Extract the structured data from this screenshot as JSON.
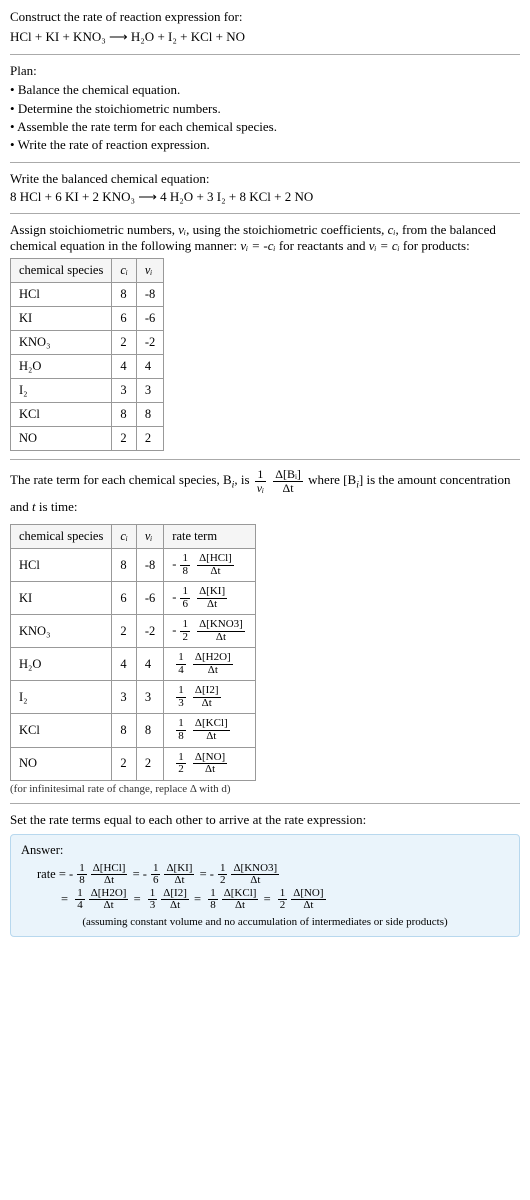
{
  "prompt": {
    "title": "Construct the rate of reaction expression for:",
    "equation_unbalanced": "HCl + KI + KNO₃  ⟶  H₂O + I₂ + KCl + NO"
  },
  "plan": {
    "title": "Plan:",
    "items": [
      "Balance the chemical equation.",
      "Determine the stoichiometric numbers.",
      "Assemble the rate term for each chemical species.",
      "Write the rate of reaction expression."
    ]
  },
  "balanced": {
    "title": "Write the balanced chemical equation:",
    "equation": "8 HCl + 6 KI + 2 KNO₃  ⟶  4 H₂O + 3 I₂ + 8 KCl + 2 NO"
  },
  "stoich": {
    "intro_a": "Assign stoichiometric numbers, ",
    "intro_b": ", using the stoichiometric coefficients, ",
    "intro_c": ", from the balanced chemical equation in the following manner: ",
    "intro_d": " for reactants and ",
    "intro_e": " for products:",
    "headers": {
      "species": "chemical species",
      "c": "cᵢ",
      "v": "νᵢ"
    },
    "rows": [
      {
        "sp": "HCl",
        "c": "8",
        "v": "-8"
      },
      {
        "sp": "KI",
        "c": "6",
        "v": "-6"
      },
      {
        "sp": "KNO₃",
        "c": "2",
        "v": "-2"
      },
      {
        "sp": "H₂O",
        "c": "4",
        "v": "4"
      },
      {
        "sp": "I₂",
        "c": "3",
        "v": "3"
      },
      {
        "sp": "KCl",
        "c": "8",
        "v": "8"
      },
      {
        "sp": "NO",
        "c": "2",
        "v": "2"
      }
    ]
  },
  "rateterm": {
    "intro_a": "The rate term for each chemical species, B",
    "intro_b": ", is ",
    "intro_c": " where [B",
    "intro_d": "] is the amount concentration and ",
    "intro_e": " is time:",
    "headers": {
      "species": "chemical species",
      "c": "cᵢ",
      "v": "νᵢ",
      "rate": "rate term"
    },
    "rows": [
      {
        "sp": "HCl",
        "c": "8",
        "v": "-8",
        "sign": "-",
        "coef_num": "1",
        "coef_den": "8",
        "conc": "Δ[HCl]",
        "dt": "Δt"
      },
      {
        "sp": "KI",
        "c": "6",
        "v": "-6",
        "sign": "-",
        "coef_num": "1",
        "coef_den": "6",
        "conc": "Δ[KI]",
        "dt": "Δt"
      },
      {
        "sp": "KNO₃",
        "c": "2",
        "v": "-2",
        "sign": "-",
        "coef_num": "1",
        "coef_den": "2",
        "conc": "Δ[KNO3]",
        "dt": "Δt"
      },
      {
        "sp": "H₂O",
        "c": "4",
        "v": "4",
        "sign": "",
        "coef_num": "1",
        "coef_den": "4",
        "conc": "Δ[H2O]",
        "dt": "Δt"
      },
      {
        "sp": "I₂",
        "c": "3",
        "v": "3",
        "sign": "",
        "coef_num": "1",
        "coef_den": "3",
        "conc": "Δ[I2]",
        "dt": "Δt"
      },
      {
        "sp": "KCl",
        "c": "8",
        "v": "8",
        "sign": "",
        "coef_num": "1",
        "coef_den": "8",
        "conc": "Δ[KCl]",
        "dt": "Δt"
      },
      {
        "sp": "NO",
        "c": "2",
        "v": "2",
        "sign": "",
        "coef_num": "1",
        "coef_den": "2",
        "conc": "Δ[NO]",
        "dt": "Δt"
      }
    ],
    "note": "(for infinitesimal rate of change, replace Δ with d)"
  },
  "chart_data": {
    "type": "table",
    "title": "Stoichiometric numbers and rate terms",
    "species": [
      "HCl",
      "KI",
      "KNO3",
      "H2O",
      "I2",
      "KCl",
      "NO"
    ],
    "c_i": [
      8,
      6,
      2,
      4,
      3,
      8,
      2
    ],
    "nu_i": [
      -8,
      -6,
      -2,
      4,
      3,
      8,
      2
    ],
    "rate_coefficients": [
      "-1/8",
      "-1/6",
      "-1/2",
      "1/4",
      "1/3",
      "1/8",
      "1/2"
    ]
  },
  "final": {
    "title": "Set the rate terms equal to each other to arrive at the rate expression:",
    "answer_label": "Answer:",
    "rate_word": "rate",
    "eq": " = ",
    "terms": [
      {
        "sign": "-",
        "num": "1",
        "den": "8",
        "conc": "Δ[HCl]",
        "dt": "Δt"
      },
      {
        "sign": "-",
        "num": "1",
        "den": "6",
        "conc": "Δ[KI]",
        "dt": "Δt"
      },
      {
        "sign": "-",
        "num": "1",
        "den": "2",
        "conc": "Δ[KNO3]",
        "dt": "Δt"
      },
      {
        "sign": "",
        "num": "1",
        "den": "4",
        "conc": "Δ[H2O]",
        "dt": "Δt"
      },
      {
        "sign": "",
        "num": "1",
        "den": "3",
        "conc": "Δ[I2]",
        "dt": "Δt"
      },
      {
        "sign": "",
        "num": "1",
        "den": "8",
        "conc": "Δ[KCl]",
        "dt": "Δt"
      },
      {
        "sign": "",
        "num": "1",
        "den": "2",
        "conc": "Δ[NO]",
        "dt": "Δt"
      }
    ],
    "note": "(assuming constant volume and no accumulation of intermediates or side products)"
  },
  "sym": {
    "nu_i": "νᵢ",
    "c_i": "cᵢ",
    "nu_eq_negc": "νᵢ = -cᵢ",
    "nu_eq_c": "νᵢ = cᵢ",
    "i": "i",
    "t": "t",
    "one": "1",
    "dBi": "Δ[Bᵢ]",
    "dt": "Δt"
  }
}
